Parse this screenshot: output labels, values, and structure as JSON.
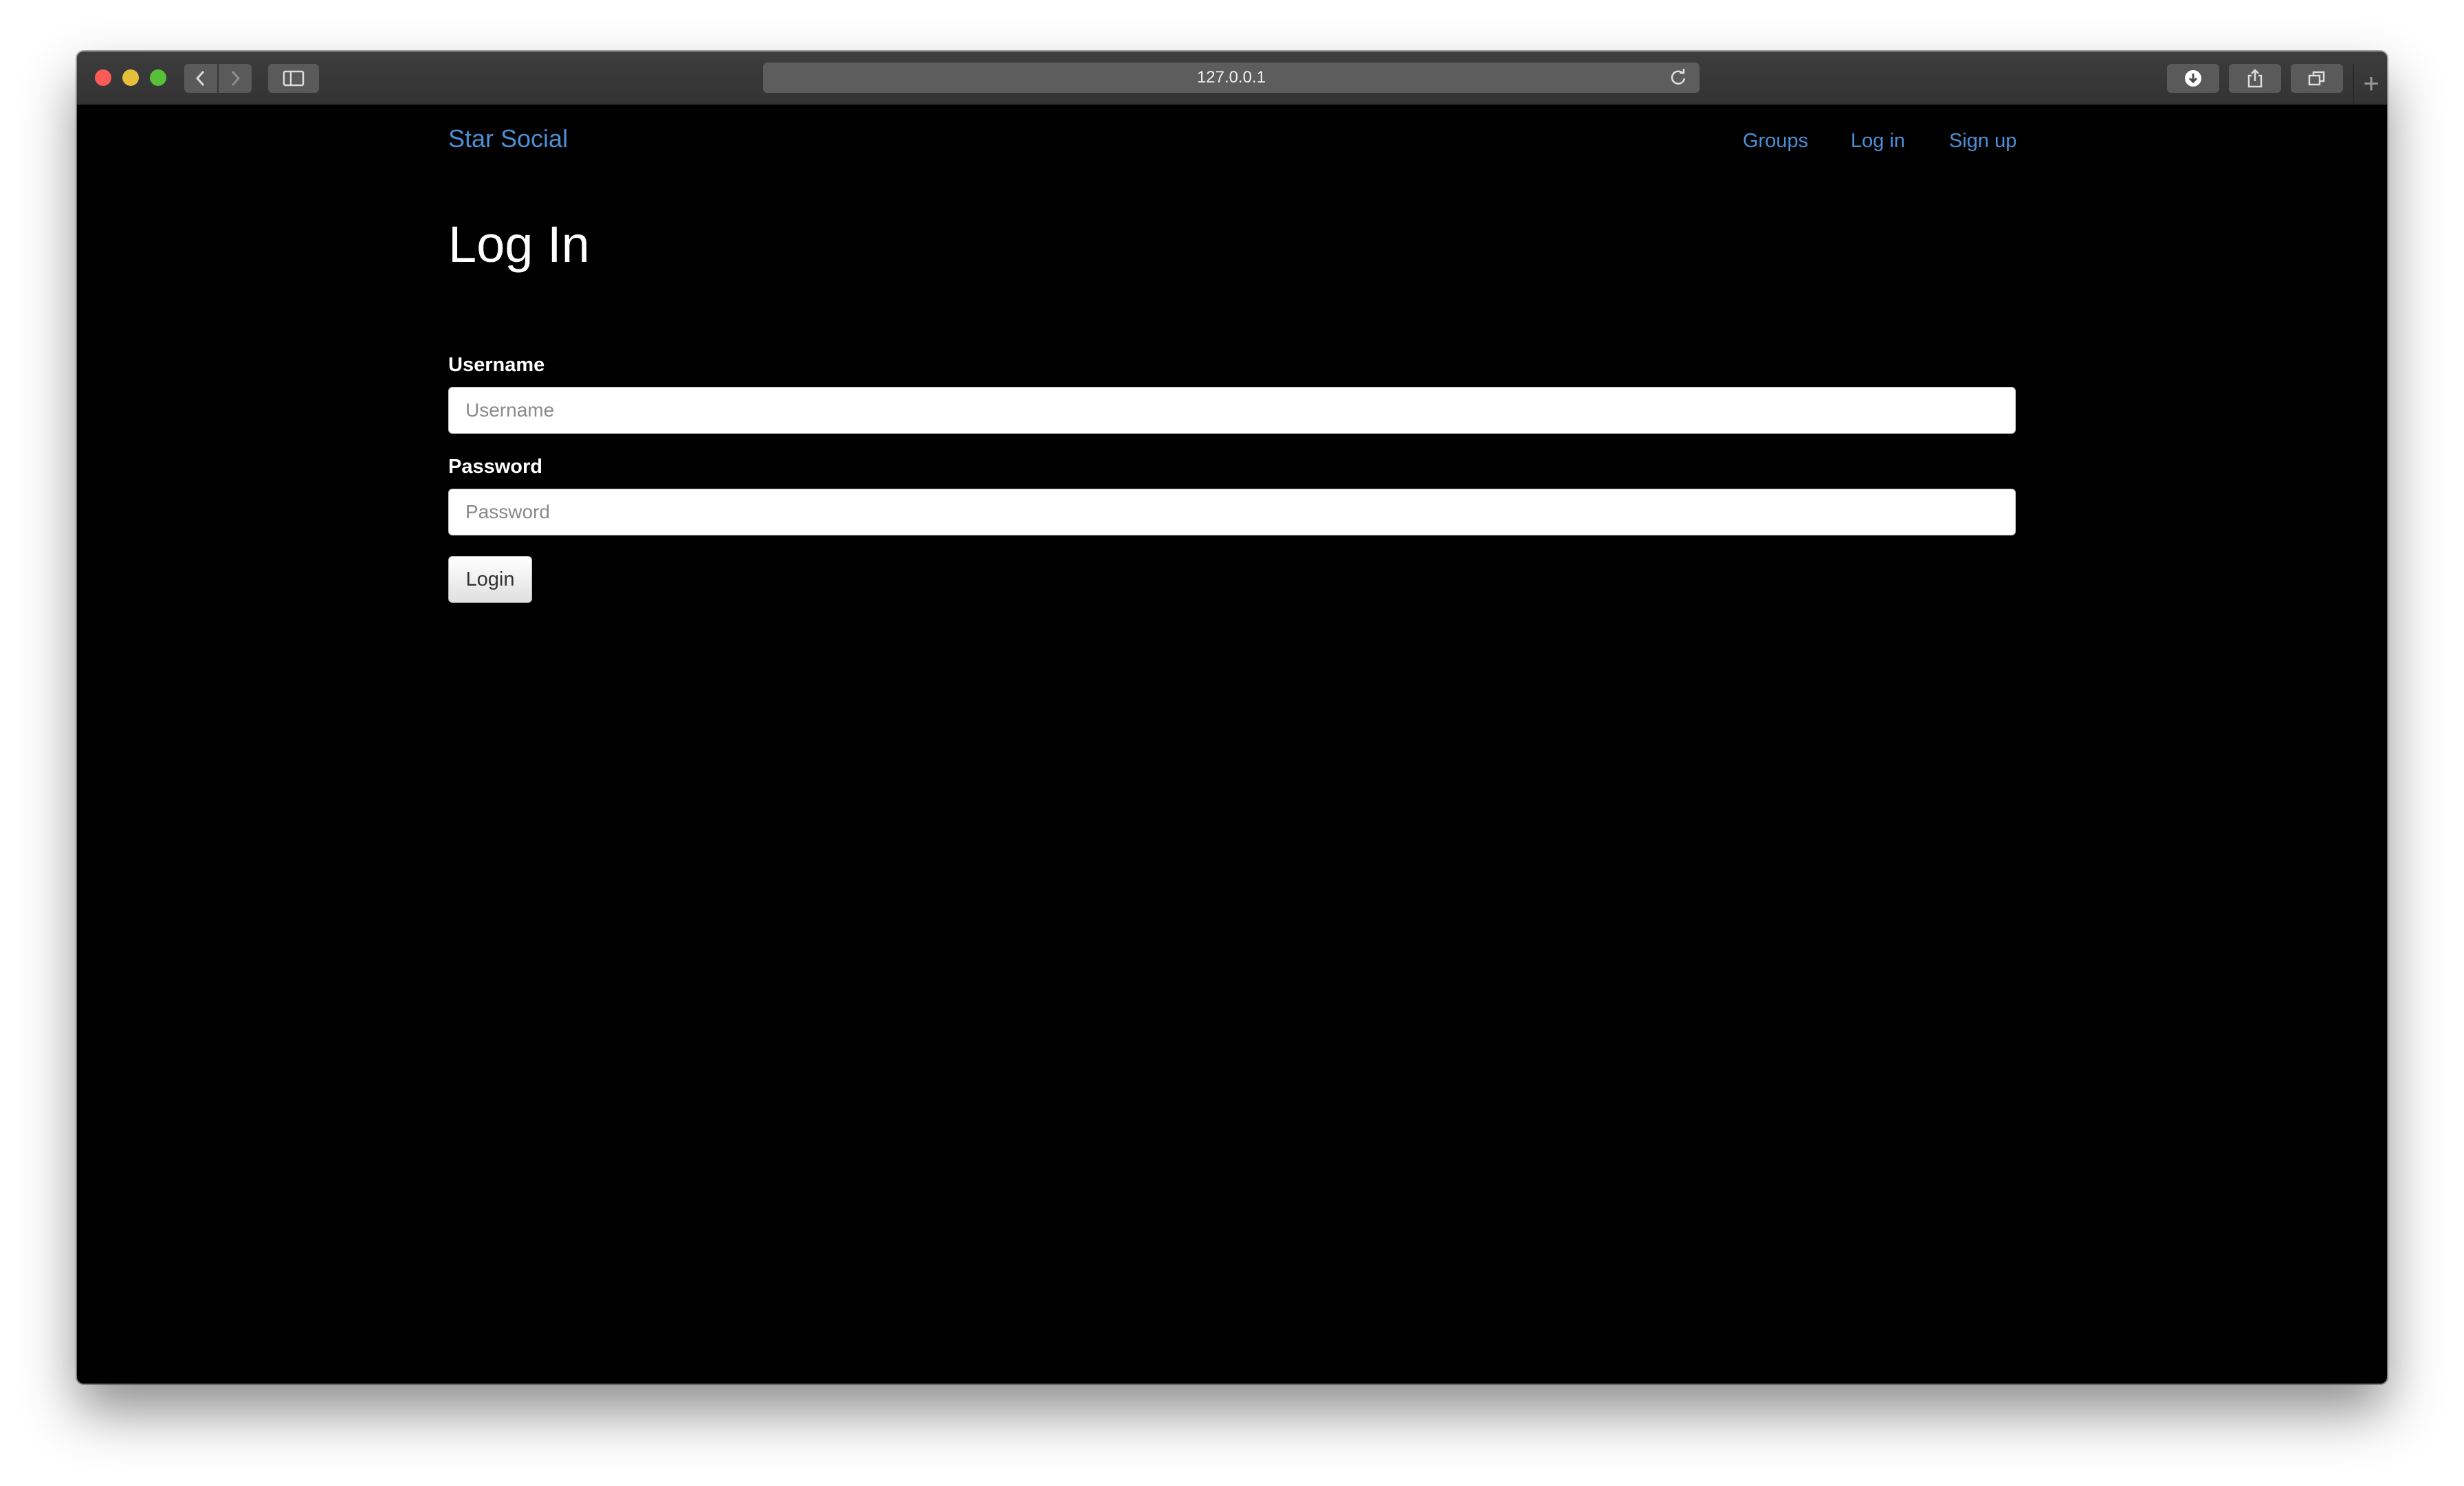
{
  "browser": {
    "address": "127.0.0.1",
    "icons": {
      "back": "chevron-left-icon",
      "forward": "chevron-right-icon",
      "sidebar": "sidebar-icon",
      "reload": "reload-icon",
      "download": "download-icon",
      "share": "share-icon",
      "tabs": "tabs-icon",
      "new_tab": "plus-icon"
    },
    "new_tab_glyph": "+"
  },
  "navbar": {
    "brand": "Star Social",
    "links": [
      "Groups",
      "Log in",
      "Sign up"
    ]
  },
  "login_form": {
    "title": "Log In",
    "username_label": "Username",
    "username_placeholder": "Username",
    "username_value": "",
    "password_label": "Password",
    "password_placeholder": "Password",
    "password_value": "",
    "submit_label": "Login"
  },
  "colors": {
    "background": "#000000",
    "link": "#4c8fd6",
    "heading": "#ffffff"
  }
}
